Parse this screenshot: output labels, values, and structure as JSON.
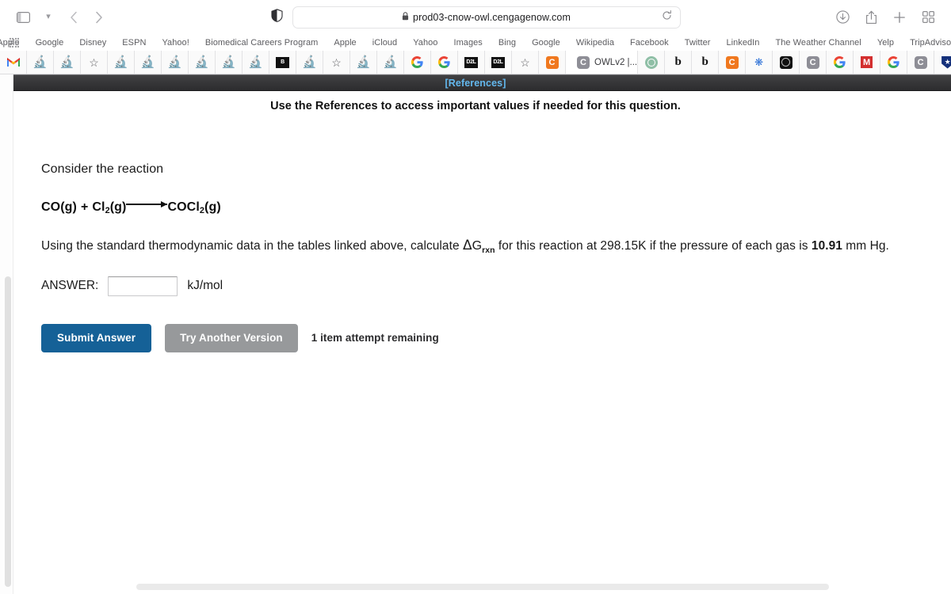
{
  "browser": {
    "url": "prod03-cnow-owl.cengagenow.com",
    "lock_icon": "lock-icon",
    "sidebar_toggle_icon": "sidebar-toggle-icon",
    "back_icon": "back-arrow-icon",
    "forward_icon": "forward-arrow-icon",
    "shield_icon": "privacy-shield-icon",
    "reload_icon": "reload-icon",
    "download_icon": "download-icon",
    "share_icon": "share-icon",
    "new_tab_icon": "plus-icon",
    "tab_overview_icon": "tab-overview-icon",
    "apps_grid_icon": "apps-grid-icon",
    "bookmarks": [
      "Apple",
      "Google",
      "Disney",
      "ESPN",
      "Yahoo!",
      "Biomedical Careers Program",
      "Apple",
      "iCloud",
      "Yahoo",
      "Images",
      "Bing",
      "Google",
      "Wikipedia",
      "Facebook",
      "Twitter",
      "LinkedIn",
      "The Weather Channel",
      "Yelp",
      "TripAdvisor"
    ],
    "active_tab_title": "OWLv2 |...",
    "favicons": [
      "gmail-icon",
      "flask-icon",
      "flask-icon",
      "star-icon",
      "flask-icon",
      "flask-icon",
      "flask-icon",
      "flask-icon",
      "flask-icon",
      "flask-icon",
      "blackboard-icon",
      "flask-icon",
      "star-icon",
      "flask-icon",
      "flask-icon",
      "google-icon",
      "google-icon",
      "d2l-icon",
      "d2l-icon",
      "star-icon",
      "cengage-icon"
    ],
    "favicons_right": [
      "chatgpt-icon",
      "bold-b-icon",
      "bold-b-icon",
      "cengage-icon",
      "sparkle-icon",
      "dark-circle-icon",
      "gray-c-icon",
      "google-icon",
      "mail-red-icon",
      "google-icon",
      "gray-c-icon",
      "shield-star-icon",
      "shield-star-icon",
      "gmail-icon"
    ]
  },
  "page": {
    "references_link": "[References]",
    "instruction": "Use the References to access important values if needed for this question.",
    "consider_text": "Consider the reaction",
    "equation": {
      "reactant1": "CO(g)",
      "plus": "+",
      "reactant2_a": "Cl",
      "reactant2_sub": "2",
      "reactant2_b": "(g)",
      "product_a": "COCl",
      "product_sub": "2",
      "product_b": "(g)"
    },
    "question": {
      "part1": "Using the standard thermodynamic data in the tables linked above, calculate ",
      "delta": "Δ",
      "g": "G",
      "subscript": "rxn",
      "part2": " for this reaction at 298.15K if the pressure of each gas is ",
      "pressure_value": "10.91",
      "part3": " mm Hg."
    },
    "answer_label": "ANSWER:",
    "answer_value": "",
    "answer_placeholder": "",
    "answer_units": "kJ/mol",
    "submit_label": "Submit Answer",
    "try_another_label": "Try Another Version",
    "attempts_text": "1 item attempt remaining"
  },
  "colors": {
    "submit_blue": "#156197",
    "try_another_gray": "#97999b",
    "references_link_blue": "#63b8ee",
    "references_bar_dark": "#2c2c2e"
  }
}
